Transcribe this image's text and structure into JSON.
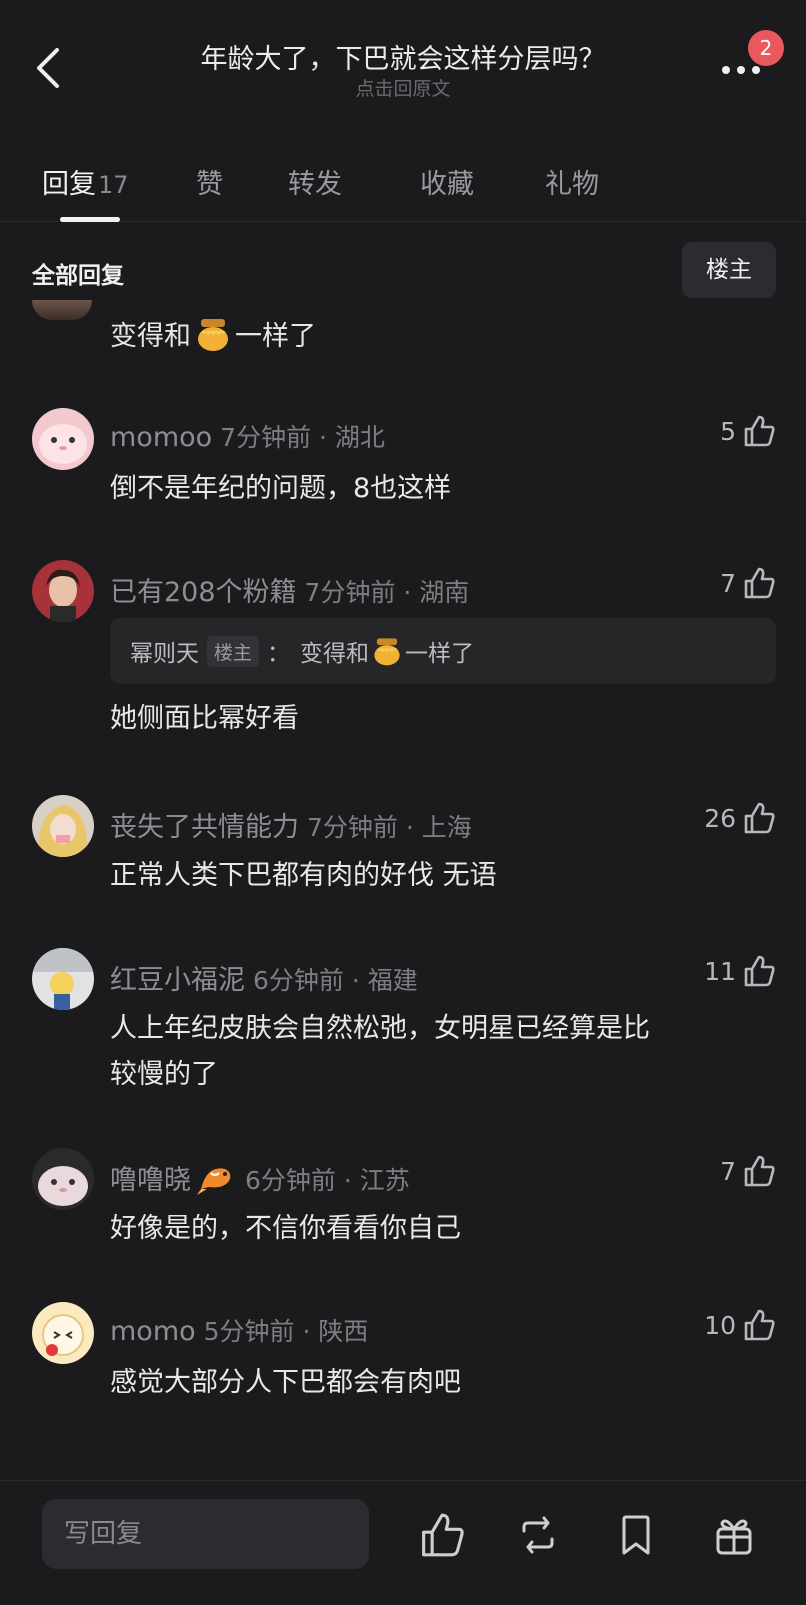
{
  "header": {
    "title": "年龄大了，下巴就会这样分层吗？",
    "subtitle": "点击回原文",
    "notification_count": "2"
  },
  "tabs": [
    {
      "label": "回复",
      "count": "17"
    },
    {
      "label": "赞"
    },
    {
      "label": "转发"
    },
    {
      "label": "收藏"
    },
    {
      "label": "礼物"
    }
  ],
  "filter": {
    "all_label": "全部回复",
    "louzhu_label": "楼主"
  },
  "partial_comment": {
    "text_before": "变得和",
    "emoji": "honey-pot-icon",
    "text_after": "一样了"
  },
  "comments": [
    {
      "user": "momoo",
      "time": "7分钟前 · 湖北",
      "likes": "5",
      "text": "倒不是年纪的问题，8也这样"
    },
    {
      "user": "已有208个粉籍",
      "time": "7分钟前 · 湖南",
      "likes": "7",
      "quote": {
        "user": "幂则天",
        "tag": "楼主",
        "sep": "：",
        "text_before": "变得和",
        "text_after": "一样了"
      },
      "text": "她侧面比幂好看"
    },
    {
      "user": "丧失了共情能力",
      "time": "7分钟前 · 上海",
      "likes": "26",
      "text": "正常人类下巴都有肉的好伐 无语"
    },
    {
      "user": "红豆小福泥",
      "time": "6分钟前 · 福建",
      "likes": "11",
      "text_line1": "人上年纪皮肤会自然松弛，女明星已经算是比",
      "text_line2": "较慢的了"
    },
    {
      "user": "噜噜晓",
      "badge_icon": "koi-fish-icon",
      "time": "6分钟前 · 江苏",
      "likes": "7",
      "text": "好像是的，不信你看看你自己"
    },
    {
      "user": "momo",
      "time": "5分钟前 · 陕西",
      "likes": "10",
      "text": "感觉大部分人下巴都会有肉吧"
    }
  ],
  "bottom_bar": {
    "reply_placeholder": "写回复",
    "icons": [
      "like-icon",
      "repost-icon",
      "bookmark-icon",
      "gift-icon"
    ]
  }
}
